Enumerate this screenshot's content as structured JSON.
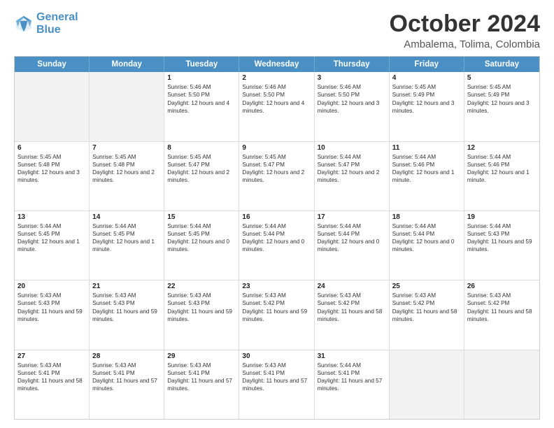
{
  "logo": {
    "line1": "General",
    "line2": "Blue"
  },
  "title": "October 2024",
  "subtitle": "Ambalema, Tolima, Colombia",
  "header_days": [
    "Sunday",
    "Monday",
    "Tuesday",
    "Wednesday",
    "Thursday",
    "Friday",
    "Saturday"
  ],
  "weeks": [
    [
      {
        "day": "",
        "text": "",
        "shaded": true
      },
      {
        "day": "",
        "text": "",
        "shaded": true
      },
      {
        "day": "1",
        "text": "Sunrise: 5:46 AM\nSunset: 5:50 PM\nDaylight: 12 hours and 4 minutes."
      },
      {
        "day": "2",
        "text": "Sunrise: 5:46 AM\nSunset: 5:50 PM\nDaylight: 12 hours and 4 minutes."
      },
      {
        "day": "3",
        "text": "Sunrise: 5:46 AM\nSunset: 5:50 PM\nDaylight: 12 hours and 3 minutes."
      },
      {
        "day": "4",
        "text": "Sunrise: 5:45 AM\nSunset: 5:49 PM\nDaylight: 12 hours and 3 minutes."
      },
      {
        "day": "5",
        "text": "Sunrise: 5:45 AM\nSunset: 5:49 PM\nDaylight: 12 hours and 3 minutes."
      }
    ],
    [
      {
        "day": "6",
        "text": "Sunrise: 5:45 AM\nSunset: 5:48 PM\nDaylight: 12 hours and 3 minutes."
      },
      {
        "day": "7",
        "text": "Sunrise: 5:45 AM\nSunset: 5:48 PM\nDaylight: 12 hours and 2 minutes."
      },
      {
        "day": "8",
        "text": "Sunrise: 5:45 AM\nSunset: 5:47 PM\nDaylight: 12 hours and 2 minutes."
      },
      {
        "day": "9",
        "text": "Sunrise: 5:45 AM\nSunset: 5:47 PM\nDaylight: 12 hours and 2 minutes."
      },
      {
        "day": "10",
        "text": "Sunrise: 5:44 AM\nSunset: 5:47 PM\nDaylight: 12 hours and 2 minutes."
      },
      {
        "day": "11",
        "text": "Sunrise: 5:44 AM\nSunset: 5:46 PM\nDaylight: 12 hours and 1 minute."
      },
      {
        "day": "12",
        "text": "Sunrise: 5:44 AM\nSunset: 5:46 PM\nDaylight: 12 hours and 1 minute."
      }
    ],
    [
      {
        "day": "13",
        "text": "Sunrise: 5:44 AM\nSunset: 5:45 PM\nDaylight: 12 hours and 1 minute."
      },
      {
        "day": "14",
        "text": "Sunrise: 5:44 AM\nSunset: 5:45 PM\nDaylight: 12 hours and 1 minute."
      },
      {
        "day": "15",
        "text": "Sunrise: 5:44 AM\nSunset: 5:45 PM\nDaylight: 12 hours and 0 minutes."
      },
      {
        "day": "16",
        "text": "Sunrise: 5:44 AM\nSunset: 5:44 PM\nDaylight: 12 hours and 0 minutes."
      },
      {
        "day": "17",
        "text": "Sunrise: 5:44 AM\nSunset: 5:44 PM\nDaylight: 12 hours and 0 minutes."
      },
      {
        "day": "18",
        "text": "Sunrise: 5:44 AM\nSunset: 5:44 PM\nDaylight: 12 hours and 0 minutes."
      },
      {
        "day": "19",
        "text": "Sunrise: 5:44 AM\nSunset: 5:43 PM\nDaylight: 11 hours and 59 minutes."
      }
    ],
    [
      {
        "day": "20",
        "text": "Sunrise: 5:43 AM\nSunset: 5:43 PM\nDaylight: 11 hours and 59 minutes."
      },
      {
        "day": "21",
        "text": "Sunrise: 5:43 AM\nSunset: 5:43 PM\nDaylight: 11 hours and 59 minutes."
      },
      {
        "day": "22",
        "text": "Sunrise: 5:43 AM\nSunset: 5:43 PM\nDaylight: 11 hours and 59 minutes."
      },
      {
        "day": "23",
        "text": "Sunrise: 5:43 AM\nSunset: 5:42 PM\nDaylight: 11 hours and 59 minutes."
      },
      {
        "day": "24",
        "text": "Sunrise: 5:43 AM\nSunset: 5:42 PM\nDaylight: 11 hours and 58 minutes."
      },
      {
        "day": "25",
        "text": "Sunrise: 5:43 AM\nSunset: 5:42 PM\nDaylight: 11 hours and 58 minutes."
      },
      {
        "day": "26",
        "text": "Sunrise: 5:43 AM\nSunset: 5:42 PM\nDaylight: 11 hours and 58 minutes."
      }
    ],
    [
      {
        "day": "27",
        "text": "Sunrise: 5:43 AM\nSunset: 5:41 PM\nDaylight: 11 hours and 58 minutes."
      },
      {
        "day": "28",
        "text": "Sunrise: 5:43 AM\nSunset: 5:41 PM\nDaylight: 11 hours and 57 minutes."
      },
      {
        "day": "29",
        "text": "Sunrise: 5:43 AM\nSunset: 5:41 PM\nDaylight: 11 hours and 57 minutes."
      },
      {
        "day": "30",
        "text": "Sunrise: 5:43 AM\nSunset: 5:41 PM\nDaylight: 11 hours and 57 minutes."
      },
      {
        "day": "31",
        "text": "Sunrise: 5:44 AM\nSunset: 5:41 PM\nDaylight: 11 hours and 57 minutes."
      },
      {
        "day": "",
        "text": "",
        "shaded": true
      },
      {
        "day": "",
        "text": "",
        "shaded": true
      }
    ]
  ]
}
